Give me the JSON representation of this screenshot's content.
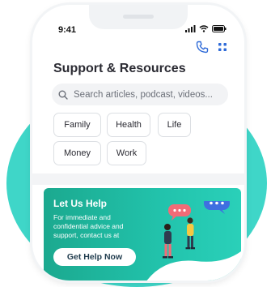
{
  "status_bar": {
    "time": "9:41"
  },
  "page": {
    "title": "Support & Resources"
  },
  "search": {
    "placeholder": "Search articles, podcast, videos..."
  },
  "chips": [
    "Family",
    "Health",
    "Life",
    "Money",
    "Work"
  ],
  "help_card": {
    "title": "Let Us Help",
    "body": "For immediate and confidential advice and support, contact us at",
    "button_label": "Get Help Now"
  },
  "icons": [
    "signal-icon",
    "wifi-icon",
    "battery-icon",
    "phone-icon",
    "grid-icon",
    "search-icon",
    "chat-bubble-icon"
  ],
  "colors": {
    "accent_blue": "#2f6bd8",
    "teal": "#3fd6c8",
    "card_teal": "#1fb89f",
    "bubble_pink": "#f26b77",
    "bubble_blue": "#3f6fe0"
  }
}
